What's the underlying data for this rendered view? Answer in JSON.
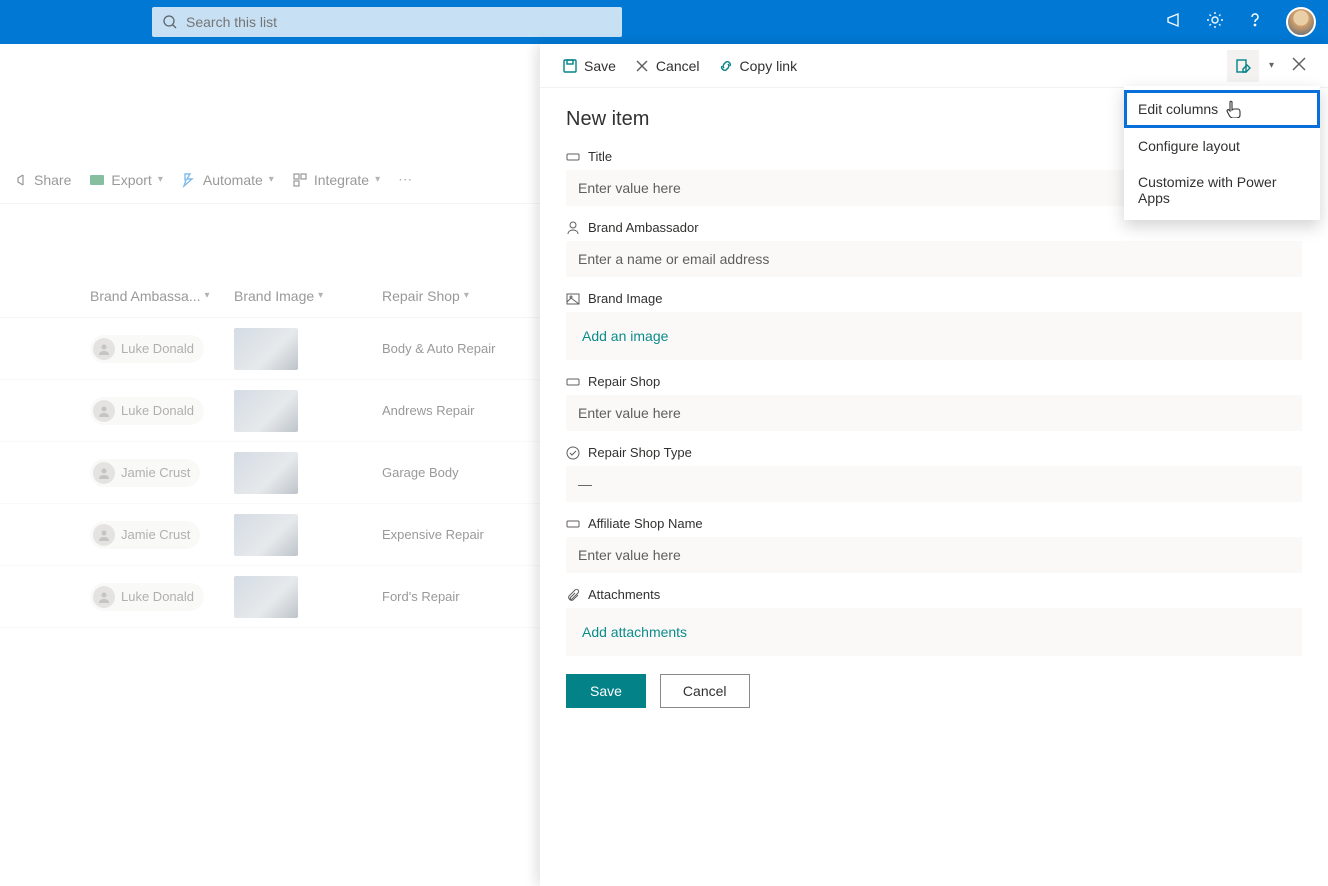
{
  "topbar": {
    "search_placeholder": "Search this list"
  },
  "cmdbar": {
    "share": "Share",
    "export": "Export",
    "automate": "Automate",
    "integrate": "Integrate"
  },
  "list": {
    "columns": {
      "ambassador": "Brand Ambassa...",
      "image": "Brand Image",
      "repair": "Repair Shop"
    },
    "rows": [
      {
        "person": "Luke Donald",
        "repair": "Body & Auto Repair"
      },
      {
        "person": "Luke Donald",
        "repair": "Andrews Repair"
      },
      {
        "person": "Jamie Crust",
        "repair": "Garage Body"
      },
      {
        "person": "Jamie Crust",
        "repair": "Expensive Repair"
      },
      {
        "person": "Luke Donald",
        "repair": "Ford's Repair"
      }
    ]
  },
  "panel": {
    "toolbar": {
      "save": "Save",
      "cancel": "Cancel",
      "copy_link": "Copy link"
    },
    "title": "New item",
    "fields": {
      "title": {
        "label": "Title",
        "placeholder": "Enter value here"
      },
      "ambassador": {
        "label": "Brand Ambassador",
        "placeholder": "Enter a name or email address"
      },
      "brand_image": {
        "label": "Brand Image",
        "action": "Add an image"
      },
      "repair_shop": {
        "label": "Repair Shop",
        "placeholder": "Enter value here"
      },
      "repair_type": {
        "label": "Repair Shop Type",
        "value": "—"
      },
      "affiliate": {
        "label": "Affiliate Shop Name",
        "placeholder": "Enter value here"
      },
      "attachments": {
        "label": "Attachments",
        "action": "Add attachments"
      }
    },
    "buttons": {
      "save": "Save",
      "cancel": "Cancel"
    }
  },
  "dropdown": {
    "edit_columns": "Edit columns",
    "configure_layout": "Configure layout",
    "customize_powerapps": "Customize with Power Apps"
  }
}
